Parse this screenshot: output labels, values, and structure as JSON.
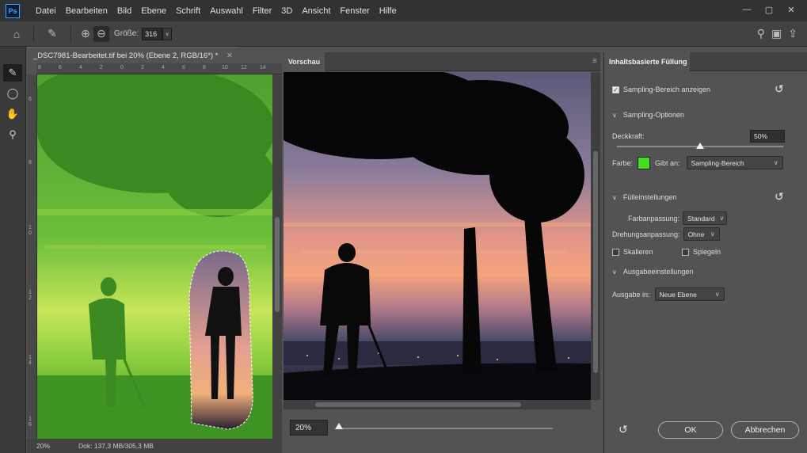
{
  "app": {
    "logo": "Ps"
  },
  "menu": [
    "Datei",
    "Bearbeiten",
    "Bild",
    "Ebene",
    "Schrift",
    "Auswahl",
    "Filter",
    "3D",
    "Ansicht",
    "Fenster",
    "Hilfe"
  ],
  "window_controls": {
    "minimize": "—",
    "maximize": "▢",
    "close": "✕"
  },
  "options": {
    "size_label": "Größe:",
    "size_value": "316",
    "size_arrow": "∨"
  },
  "icons": {
    "home": "⌂",
    "brush_preset": "✎",
    "add_mode": "⊕",
    "subtract_mode": "⊖",
    "search": "⚲",
    "workspace": "▣",
    "share": "⇪",
    "tool_brush": "✎",
    "tool_lasso": "◯",
    "tool_hand": "✋",
    "tool_zoom": "⚲",
    "reset": "↺",
    "panel_menu": "≡",
    "tab_close": "✕"
  },
  "document": {
    "tab_title": "_DSC7981-Bearbeitet.tif bei 20% (Ebene 2, RGB/16*) *",
    "ruler_top_ticks": [
      "8",
      "6",
      "4",
      "2",
      "0",
      "2",
      "4",
      "6",
      "8",
      "10",
      "12",
      "14"
    ],
    "ruler_left_ticks": [
      "6",
      "8",
      "1 0",
      "1 2",
      "1 4",
      "1 6"
    ],
    "zoom": "20%",
    "doc_info": "Dok: 137,3 MB/305,3 MB"
  },
  "preview": {
    "tab": "Vorschau",
    "zoom": "20%",
    "zoom_fraction": 0.0
  },
  "panel": {
    "title": "Inhaltsbasierte Füllung",
    "show_sampling": "Sampling-Bereich anzeigen",
    "show_sampling_checked": true,
    "sampling_options": "Sampling-Optionen",
    "opacity_label": "Deckkraft:",
    "opacity_value": "50%",
    "opacity_fraction": 0.5,
    "color_label": "Farbe:",
    "color_swatch": "#44dd22",
    "indicates_label": "Gibt an:",
    "indicates_value": "Sampling-Bereich",
    "fill_settings": "Fülleinstellungen",
    "color_adapt_label": "Farbanpassung:",
    "color_adapt_value": "Standard",
    "rotation_adapt_label": "Drehungsanpassung:",
    "rotation_adapt_value": "Ohne",
    "scale_label": "Skalieren",
    "mirror_label": "Spiegeln",
    "output_settings": "Ausgabeeinstellungen",
    "output_label": "Ausgabe in:",
    "output_value": "Neue Ebene",
    "ok": "OK",
    "cancel": "Abbrechen"
  }
}
